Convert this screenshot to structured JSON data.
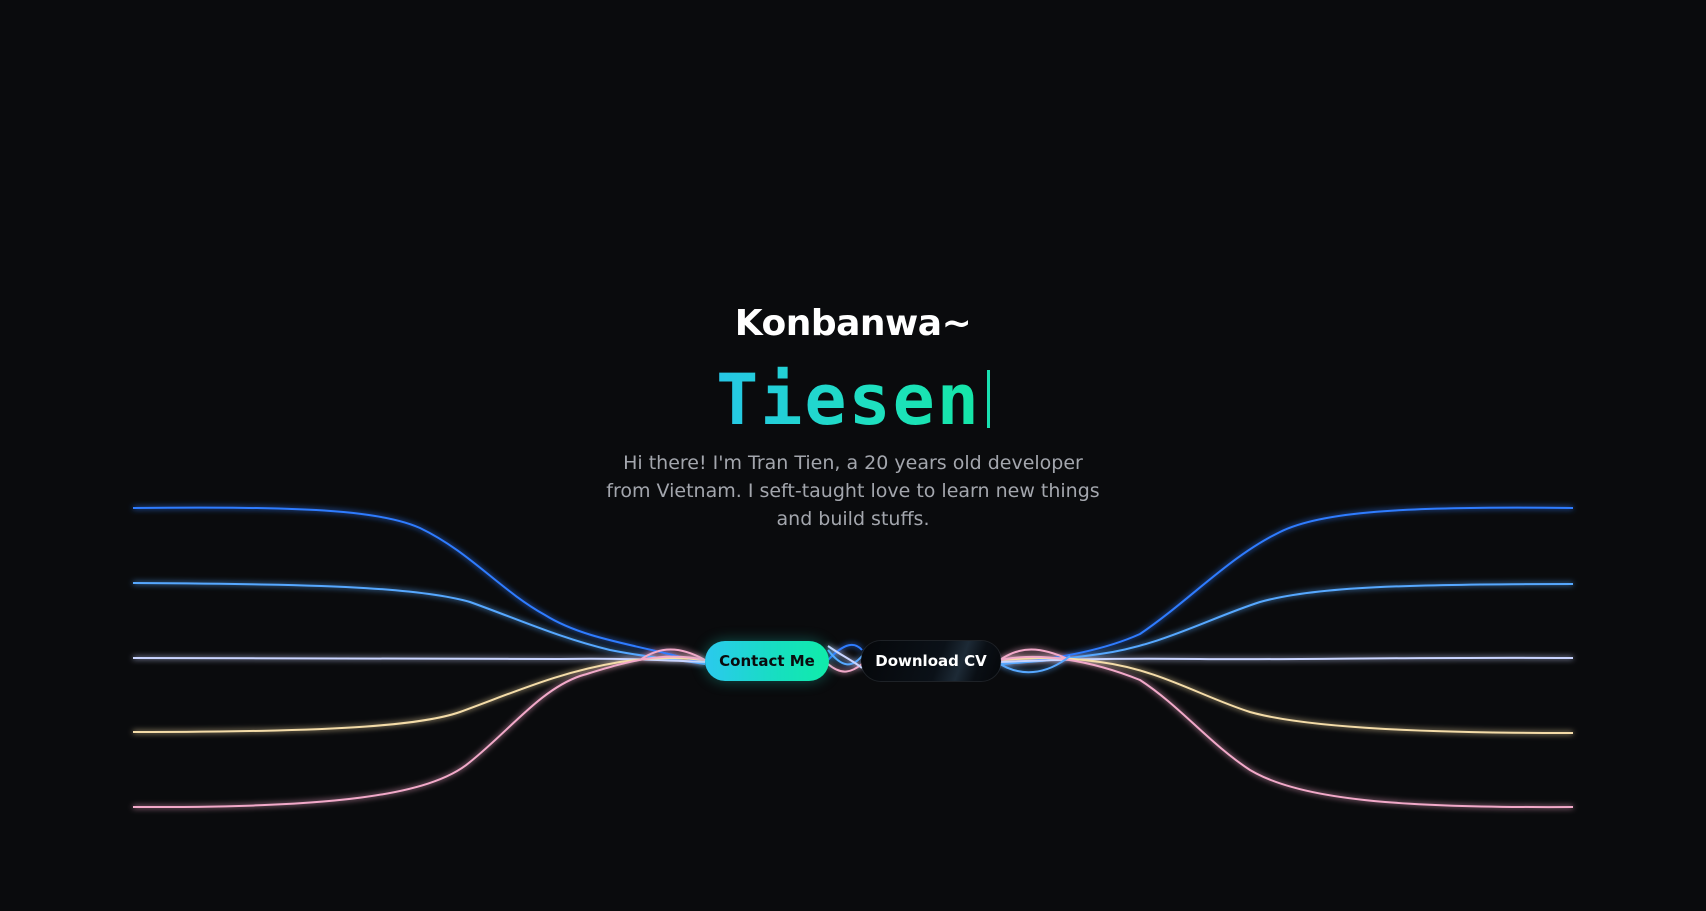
{
  "hero": {
    "greeting": "Konbanwa~",
    "name": "Tiesen",
    "intro": "Hi there! I'm Tran Tien, a 20 years old developer from Vietnam. I seft-taught love to learn new things and build stuffs."
  },
  "buttons": {
    "contact_label": "Contact Me",
    "cv_label": "Download CV"
  },
  "theme": {
    "background": "#0a0b0d",
    "accent_gradient_start": "#26c6e6",
    "accent_gradient_end": "#14e6a6",
    "line_colors": [
      "#2f7bff",
      "#57a8ff",
      "#c9d4ff",
      "#f4dca8",
      "#f2a9c9"
    ]
  }
}
